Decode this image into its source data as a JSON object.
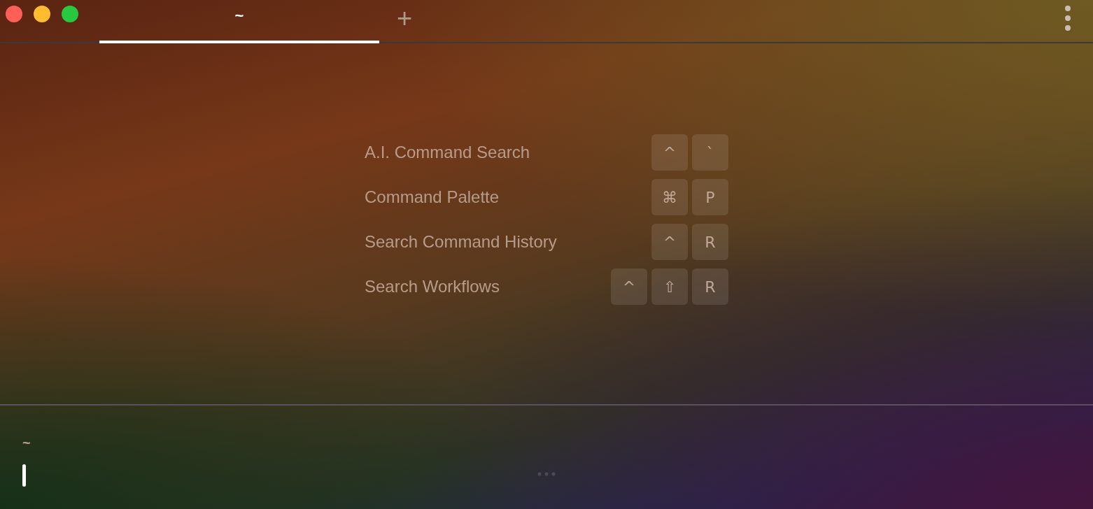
{
  "tabs": [
    {
      "label": "~",
      "selected": true
    }
  ],
  "new_tab": "+",
  "shortcuts": [
    {
      "label": "A.I. Command Search",
      "keys": [
        "^",
        "`"
      ]
    },
    {
      "label": "Command Palette",
      "keys": [
        "⌘",
        "P"
      ]
    },
    {
      "label": "Search Command History",
      "keys": [
        "^",
        "R"
      ]
    },
    {
      "label": "Search Workflows",
      "keys": [
        "^",
        "⇧",
        "R"
      ]
    }
  ],
  "prompt": {
    "directory": "~"
  }
}
